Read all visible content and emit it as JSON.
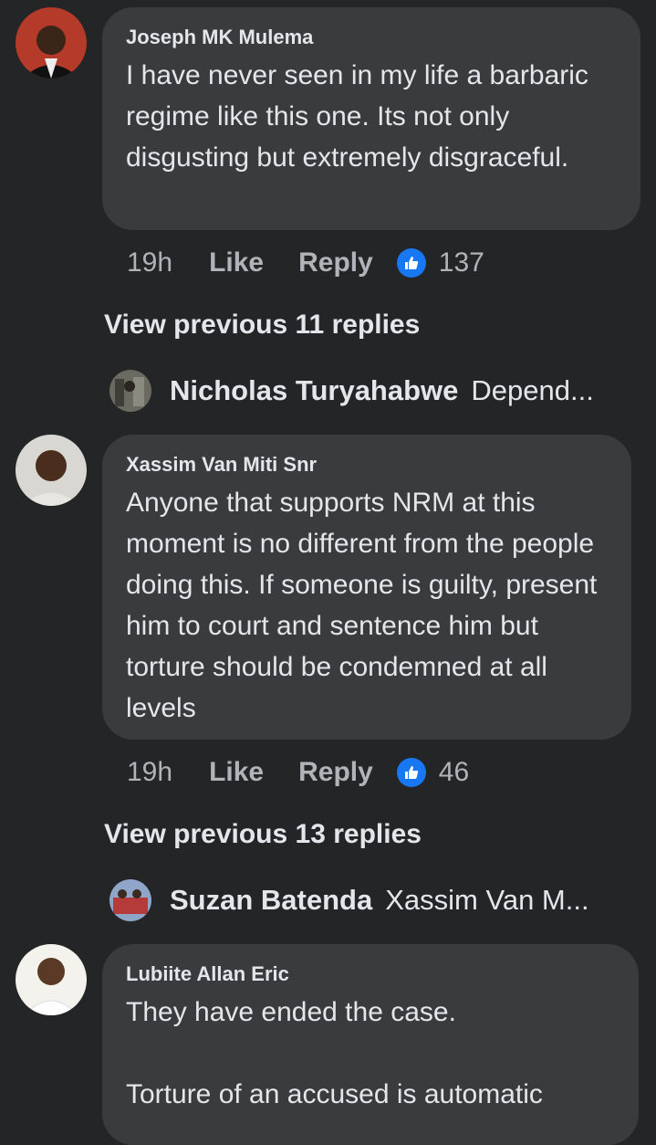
{
  "comments": [
    {
      "author": "Joseph MK Mulema",
      "text": "I have never seen in my life a barbaric regime like this one. Its not only disgusting but extremely disgraceful.",
      "time": "19h",
      "like_label": "Like",
      "reply_label": "Reply",
      "reaction_count": "137",
      "view_previous": "View previous 11 replies",
      "latest_reply": {
        "author": "Nicholas Turyahabwe",
        "snippet": "Depend..."
      }
    },
    {
      "author": "Xassim Van Miti Snr",
      "text": "Anyone that supports NRM at this moment is no different from the people doing this. If someone is guilty, present him to court and sentence him but torture should be condemned at all levels",
      "time": "19h",
      "like_label": "Like",
      "reply_label": "Reply",
      "reaction_count": "46",
      "view_previous": "View previous 13 replies",
      "latest_reply": {
        "author": "Suzan Batenda",
        "snippet": "Xassim Van M..."
      }
    },
    {
      "author": "Lubiite Allan Eric",
      "text": "They have ended the case.\n\nTorture of an accused is automatic"
    }
  ],
  "icons": {
    "reaction": "thumbs-up-like-icon"
  },
  "colors": {
    "background": "#242526",
    "bubble": "#3a3b3c",
    "like_blue": "#1877f2",
    "secondary_text": "#b0b3b8"
  }
}
